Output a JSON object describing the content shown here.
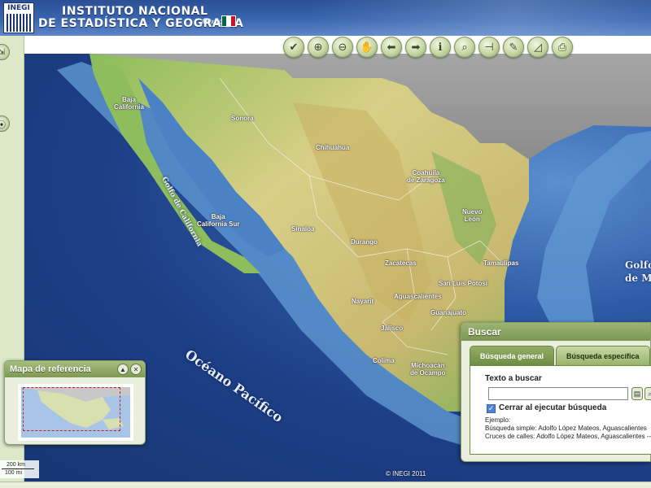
{
  "header": {
    "logo_text": "INEGI",
    "title_line1": "INSTITUTO NACIONAL",
    "title_line2": "DE ESTADÍSTICA Y GEOGRAFÍA",
    "country": "México",
    "flag_colors": [
      "#006847",
      "#ffffff",
      "#ce1126"
    ]
  },
  "toolbar": {
    "tools": [
      {
        "name": "check-tool",
        "glyph": "✔"
      },
      {
        "name": "zoom-in-tool",
        "glyph": "⊕"
      },
      {
        "name": "zoom-out-tool",
        "glyph": "⊖"
      },
      {
        "name": "pan-tool",
        "glyph": "✋"
      },
      {
        "name": "back-tool",
        "glyph": "⬅"
      },
      {
        "name": "forward-tool",
        "glyph": "➡"
      },
      {
        "name": "info-tool",
        "glyph": "ℹ"
      },
      {
        "name": "binoculars-tool",
        "glyph": "⌕"
      },
      {
        "name": "layers-tool",
        "glyph": "⊣"
      },
      {
        "name": "pencil-tool",
        "glyph": "✎"
      },
      {
        "name": "measure-tool",
        "glyph": "◿"
      },
      {
        "name": "print-tool",
        "glyph": "⎙"
      }
    ]
  },
  "map": {
    "labels": {
      "baja_california": "Baja\nCalifornia",
      "sonora": "Sonora",
      "chihuahua": "Chihuahua",
      "coahuila": "Coahuila\nde Zaragoza",
      "nuevo_leon": "Nuevo\nLeón",
      "baja_california_sur": "Baja\nCalifornia Sur",
      "sinaloa": "Sinaloa",
      "durango": "Durango",
      "tamaulipas": "Tamaulipas",
      "zacatecas": "Zacatecas",
      "san_luis_potosi": "San Luis Potosí",
      "nayarit": "Nayarit",
      "aguascalientes": "Aguascalientes",
      "guanajuato": "Guanajuato",
      "jalisco": "Jalisco",
      "colima": "Colima",
      "michoacan": "Michoacán\nde Ocampo"
    },
    "golfo_california": "Golfo de California",
    "oceano_pacifico": "Océano Pacífico",
    "golfo_mexico": "Golfo\nde Mé",
    "copyright": "© INEGI 2011",
    "scale_km": "200 km",
    "scale_mi": "100 mi"
  },
  "reference_panel": {
    "title": "Mapa de referencia"
  },
  "search_panel": {
    "title": "Buscar",
    "tab_general": "Búsqueda general",
    "tab_specific": "Búsqueda específica",
    "search_label": "Texto a buscar",
    "search_value": "",
    "close_on_search_label": "Cerrar al ejecutar búsqueda",
    "close_on_search_checked": true,
    "example_title": "Ejemplo:",
    "example_simple": "Búsqueda simple: Adolfo López Mateos, Aguascalientes",
    "example_streets": "Cruces de calles: Adolfo López Mateos, Aguascalientes --"
  }
}
